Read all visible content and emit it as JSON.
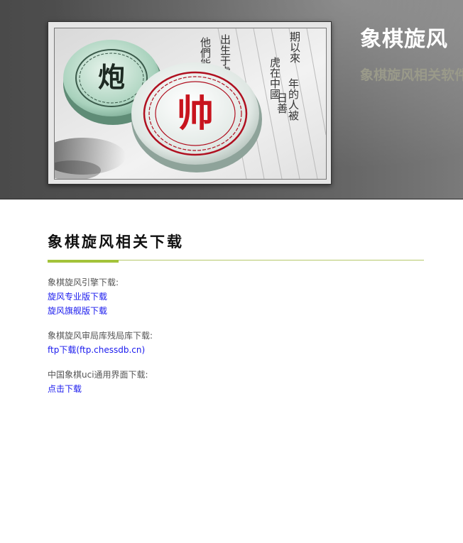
{
  "header": {
    "title": "象棋旋风",
    "subtitle": "象棋旋风相关软件",
    "image": {
      "left_piece_char": "炮",
      "right_piece_char": "帅",
      "book_text_columns": [
        "他們能夠",
        "出生于虎",
        "虎在中國",
        "期以來",
        "年的人被",
        "日善"
      ]
    }
  },
  "main": {
    "heading": "象棋旋风相关下载",
    "sections": [
      {
        "label": "象棋旋风引擎下载:",
        "links": [
          "旋风专业版下载",
          "旋风旗舰版下载"
        ]
      },
      {
        "label": "象棋旋风审局库残局库下载:",
        "links": [
          "ftp下载(ftp.chessdb.cn)"
        ]
      },
      {
        "label": "中国象棋uci通用界面下载:",
        "links": [
          "点击下载"
        ]
      }
    ]
  },
  "colors": {
    "header_bg": "#555555",
    "accent_green": "#a3c33a",
    "link_blue": "#1a1aee",
    "text_gray": "#555555"
  }
}
